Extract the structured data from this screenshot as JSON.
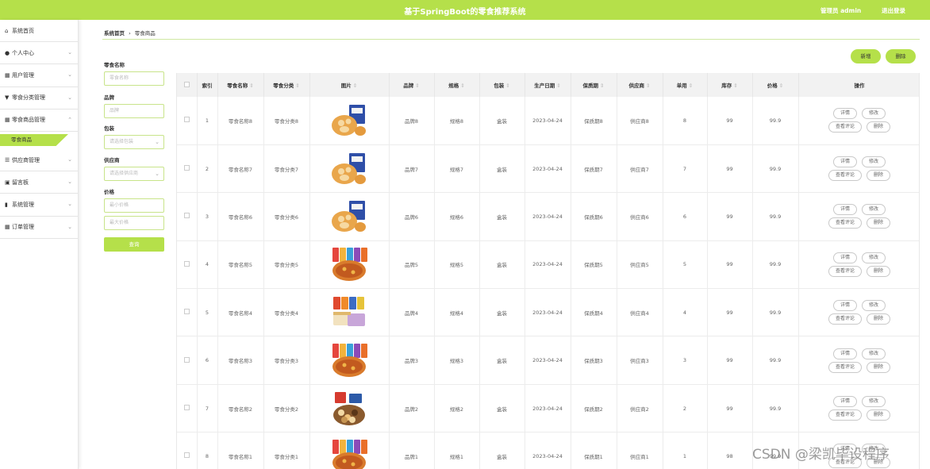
{
  "header": {
    "title": "基于SpringBoot的零食推荐系统",
    "user": "管理员 admin",
    "logout": "退出登录"
  },
  "sidebar": {
    "items": [
      {
        "label": "系统首页",
        "icon": "home-icon",
        "glyph": "⌂",
        "chevron": false
      },
      {
        "label": "个人中心",
        "icon": "user-icon",
        "glyph": "●",
        "chevron": true
      },
      {
        "label": "用户管理",
        "icon": "grid-icon",
        "glyph": "▦",
        "chevron": true
      },
      {
        "label": "零食分类管理",
        "icon": "category-icon",
        "glyph": "▼",
        "chevron": true
      },
      {
        "label": "零食商品管理",
        "icon": "grid-icon",
        "glyph": "▦",
        "chevron": true,
        "expanded": true
      }
    ],
    "active_sub": "零食商品",
    "items_after": [
      {
        "label": "供应商管理",
        "icon": "list-icon",
        "glyph": "☰",
        "chevron": true
      },
      {
        "label": "留言板",
        "icon": "book-icon",
        "glyph": "▣",
        "chevron": true
      },
      {
        "label": "系统管理",
        "icon": "bar-chart-icon",
        "glyph": "▮",
        "chevron": true
      },
      {
        "label": "订单管理",
        "icon": "grid-icon",
        "glyph": "▦",
        "chevron": true
      }
    ]
  },
  "breadcrumb": {
    "home": "系统首页",
    "sep": "›",
    "current": "零食商品"
  },
  "filters": {
    "name_label": "零食名称",
    "name_placeholder": "零食名称",
    "brand_label": "品牌",
    "brand_placeholder": "品牌",
    "pack_label": "包装",
    "pack_placeholder": "请选择包装",
    "supplier_label": "供应商",
    "supplier_placeholder": "请选择供应商",
    "price_label": "价格",
    "price_min_placeholder": "最小价格",
    "price_max_placeholder": "最大价格",
    "query_label": "查询"
  },
  "actions": {
    "add": "新增",
    "delete": "删除"
  },
  "table": {
    "headers": [
      "索引",
      "零食名称",
      "零食分类",
      "图片",
      "品牌",
      "规格",
      "包装",
      "生产日期",
      "保质期",
      "供应商",
      "单用",
      "库存",
      "价格",
      "操作"
    ],
    "op_labels": {
      "detail": "详情",
      "edit": "修改",
      "review": "查看评论",
      "delete": "删除"
    },
    "rows": [
      {
        "idx": "1",
        "name": "零食名称8",
        "cat": "零食分类8",
        "brand": "品牌8",
        "spec": "规格8",
        "pack": "盒装",
        "date": "2023-04-24",
        "shelf": "保质期8",
        "supplier": "供应商8",
        "unit": "8",
        "stock": "99",
        "price": "99.9",
        "img": "box"
      },
      {
        "idx": "2",
        "name": "零食名称7",
        "cat": "零食分类7",
        "brand": "品牌7",
        "spec": "规格7",
        "pack": "盒装",
        "date": "2023-04-24",
        "shelf": "保质期7",
        "supplier": "供应商7",
        "unit": "7",
        "stock": "99",
        "price": "99.9",
        "img": "box"
      },
      {
        "idx": "3",
        "name": "零食名称6",
        "cat": "零食分类6",
        "brand": "品牌6",
        "spec": "规格6",
        "pack": "盒装",
        "date": "2023-04-24",
        "shelf": "保质期6",
        "supplier": "供应商6",
        "unit": "6",
        "stock": "99",
        "price": "99.9",
        "img": "box"
      },
      {
        "idx": "4",
        "name": "零食名称5",
        "cat": "零食分类5",
        "brand": "品牌5",
        "spec": "规格5",
        "pack": "盒装",
        "date": "2023-04-24",
        "shelf": "保质期5",
        "supplier": "供应商5",
        "unit": "5",
        "stock": "99",
        "price": "99.9",
        "img": "mix"
      },
      {
        "idx": "5",
        "name": "零食名称4",
        "cat": "零食分类4",
        "brand": "品牌4",
        "spec": "规格4",
        "pack": "盒装",
        "date": "2023-04-24",
        "shelf": "保质期4",
        "supplier": "供应商4",
        "unit": "4",
        "stock": "99",
        "price": "99.9",
        "img": "cake"
      },
      {
        "idx": "6",
        "name": "零食名称3",
        "cat": "零食分类3",
        "brand": "品牌3",
        "spec": "规格3",
        "pack": "盒装",
        "date": "2023-04-24",
        "shelf": "保质期3",
        "supplier": "供应商3",
        "unit": "3",
        "stock": "99",
        "price": "99.9",
        "img": "mix"
      },
      {
        "idx": "7",
        "name": "零食名称2",
        "cat": "零食分类2",
        "brand": "品牌2",
        "spec": "规格2",
        "pack": "盒装",
        "date": "2023-04-24",
        "shelf": "保质期2",
        "supplier": "供应商2",
        "unit": "2",
        "stock": "99",
        "price": "99.9",
        "img": "nuts"
      },
      {
        "idx": "8",
        "name": "零食名称1",
        "cat": "零食分类1",
        "brand": "品牌1",
        "spec": "规格1",
        "pack": "盒装",
        "date": "2023-04-24",
        "shelf": "保质期1",
        "supplier": "供应商1",
        "unit": "1",
        "stock": "98",
        "price": "99.9",
        "img": "mix"
      }
    ]
  },
  "watermark": "CSDN @梁凯毕设程序",
  "colors": {
    "accent": "#b5e04a"
  }
}
